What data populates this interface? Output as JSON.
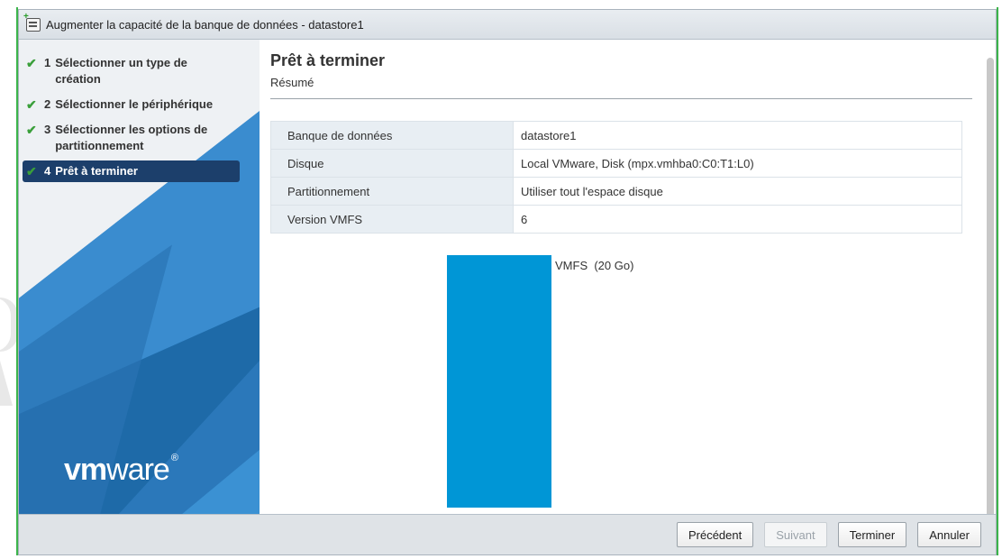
{
  "dialog": {
    "title": "Augmenter la capacité de la banque de données - datastore1"
  },
  "nav": {
    "steps": [
      {
        "num": "1",
        "label": "Sélectionner un type de création",
        "done": true,
        "active": false
      },
      {
        "num": "2",
        "label": "Sélectionner le périphérique",
        "done": true,
        "active": false
      },
      {
        "num": "3",
        "label": "Sélectionner les options de partitionnement",
        "done": true,
        "active": false
      },
      {
        "num": "4",
        "label": "Prêt à terminer",
        "done": true,
        "active": true
      }
    ],
    "logo_bold": "vm",
    "logo_rest": "ware",
    "logo_reg": "®"
  },
  "main": {
    "title": "Prêt à terminer",
    "subtitle": "Résumé",
    "summary": [
      {
        "key": "Banque de données",
        "value": "datastore1"
      },
      {
        "key": "Disque",
        "value": "Local VMware, Disk (mpx.vmhba0:C0:T1:L0)"
      },
      {
        "key": "Partitionnement",
        "value": "Utiliser tout l'espace disque"
      },
      {
        "key": "Version VMFS",
        "value": "6"
      }
    ],
    "partition_label": "VMFS  (20 Go)"
  },
  "footer": {
    "prev": "Précédent",
    "next": "Suivant",
    "finish": "Terminer",
    "cancel": "Annuler"
  },
  "colors": {
    "accent": "#1c3f6b",
    "partition": "#0096d6",
    "check": "#3a9f3a"
  }
}
